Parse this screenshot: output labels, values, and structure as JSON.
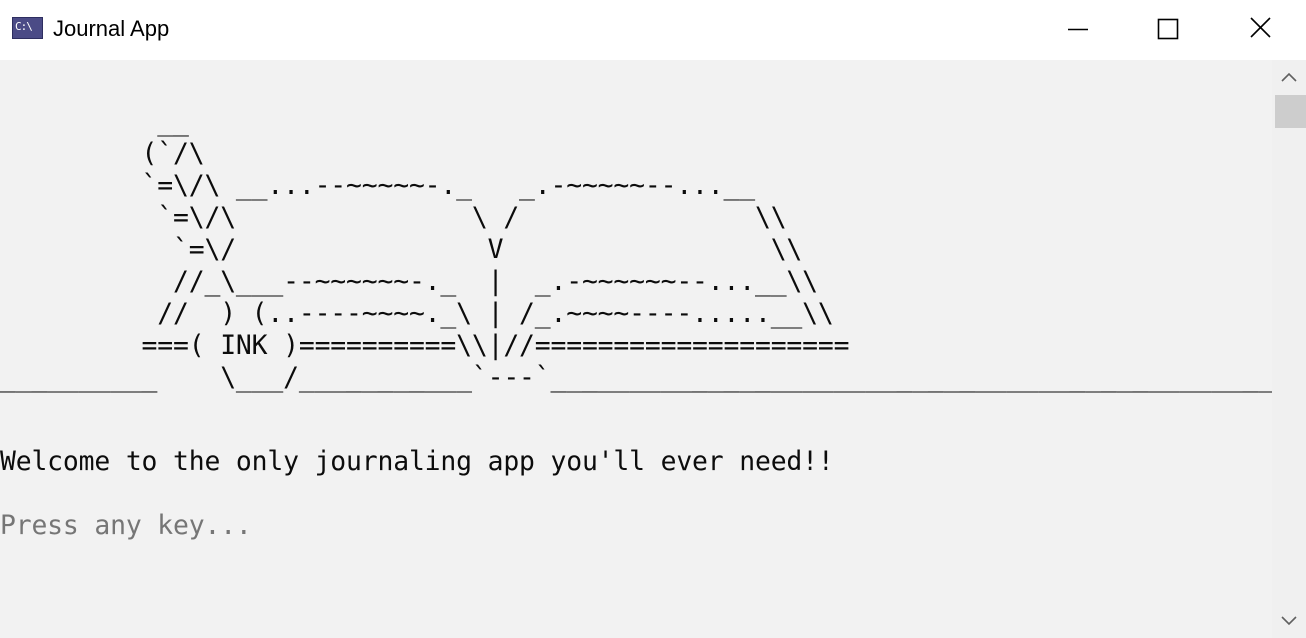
{
  "window": {
    "title": "Journal App",
    "icon": "console-app-icon",
    "icon_text": "C:\\",
    "controls": {
      "minimize_icon": "minimize-icon",
      "maximize_icon": "maximize-icon",
      "close_icon": "close-icon"
    }
  },
  "console": {
    "banner_lines": [
      "          __",
      "         (`/\\",
      "         `=\\/\\ __...--~~~~~-._   _.-~~~~~--...__",
      "          `=\\/\\               \\ /               \\\\",
      "           `=\\/                V                 \\\\",
      "           //_\\___--~~~~~~-._  |  _.-~~~~~~--...__\\\\",
      "          //  ) (..----~~~~._\\ | /_.~~~~----.....__\\\\",
      "         ===( INK )==========\\\\|//====================",
      "__________    \\___/___________`---`________________________________________________"
    ],
    "welcome": "Welcome to the only journaling app you'll ever need!!",
    "prompt": "Press any key...",
    "background": "#f2f2f2",
    "text_color": "#0c0c0c",
    "prompt_color": "#767676"
  },
  "scrollbar": {
    "up_icon": "scroll-up-arrow-icon",
    "down_icon": "scroll-down-arrow-icon"
  }
}
